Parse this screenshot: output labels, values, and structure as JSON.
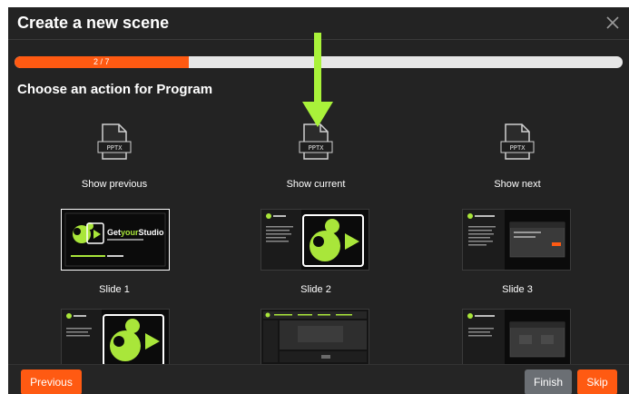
{
  "dialog": {
    "title": "Create a new scene",
    "close_icon": "close-icon"
  },
  "progress": {
    "label": "2 / 7",
    "current": 2,
    "total": 7,
    "fraction": 0.286
  },
  "section_title": "Choose an action for Program",
  "actions": [
    {
      "label": "Show previous",
      "icon": "pptx-file-icon",
      "file_badge": "PPTX"
    },
    {
      "label": "Show current",
      "icon": "pptx-file-icon",
      "file_badge": "PPTX"
    },
    {
      "label": "Show next",
      "icon": "pptx-file-icon",
      "file_badge": "PPTX"
    }
  ],
  "slides": [
    {
      "label": "Slide 1",
      "brand_text": "GetyourStudio",
      "brand_parts": [
        "Get",
        "your",
        "Studio"
      ]
    },
    {
      "label": "Slide 2"
    },
    {
      "label": "Slide 3"
    },
    {
      "label": ""
    },
    {
      "label": ""
    },
    {
      "label": ""
    }
  ],
  "footer": {
    "previous_label": "Previous",
    "finish_label": "Finish",
    "skip_label": "Skip"
  },
  "colors": {
    "accent": "#ff5a12",
    "dialog_bg": "#232323",
    "arrow": "#a9f23a",
    "brand_green": "#a9e63a",
    "finish_bg": "#6b6f74"
  }
}
